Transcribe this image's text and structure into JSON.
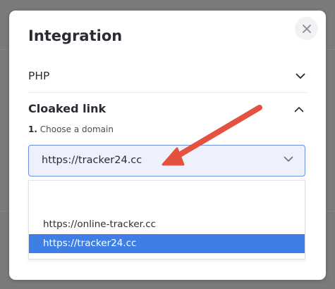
{
  "modal": {
    "title": "Integration",
    "php_section": {
      "label": "PHP"
    },
    "cloaked_section": {
      "label": "Cloaked link",
      "step_number": "1.",
      "step_text": "Choose a domain",
      "select": {
        "value": "https://tracker24.cc"
      },
      "dropdown": {
        "options": [
          {
            "label": ""
          },
          {
            "label": "https://online-tracker.cc"
          },
          {
            "label": "https://tracker24.cc",
            "selected": true
          }
        ]
      }
    }
  },
  "colors": {
    "annotation_arrow": "#e4513f",
    "selected_option": "#3d7fe4",
    "select_border": "#6b8fe3"
  },
  "icons": [
    "close-icon",
    "chevron-down-icon",
    "chevron-up-icon",
    "annotation-arrow"
  ]
}
